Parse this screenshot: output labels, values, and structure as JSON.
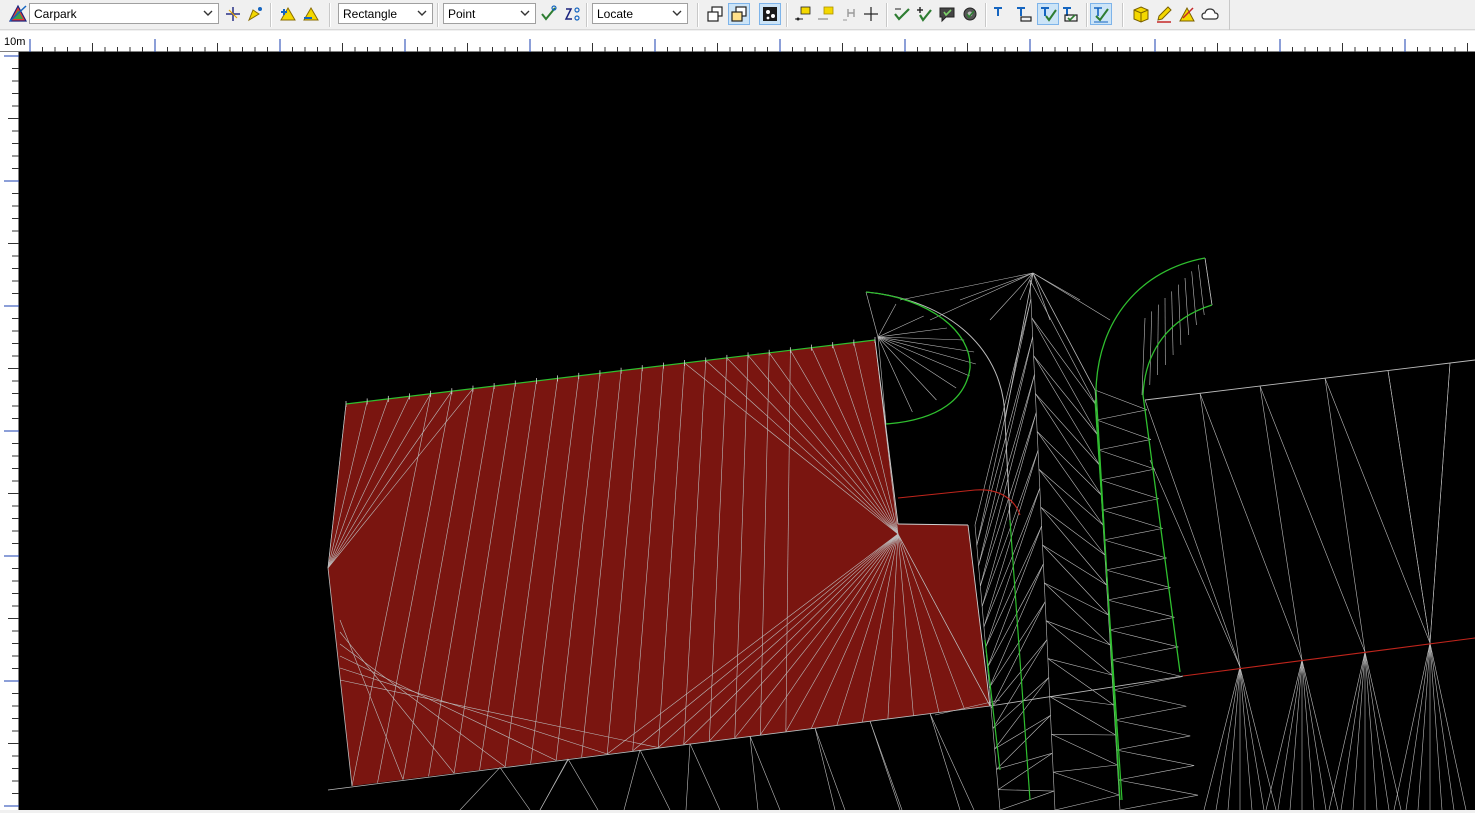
{
  "toolbar": {
    "layer_select": {
      "value": "Carpark"
    },
    "selection_mode_select": {
      "value": "Rectangle"
    },
    "snap_mode_select": {
      "value": "Point"
    },
    "action_select": {
      "value": "Locate"
    },
    "icons": [
      "layer-colour-icon",
      "crosshair-icon",
      "pen-select-icon",
      "triangle-add-icon",
      "triangle-remove-icon",
      "point-check-icon",
      "point-edit-icon",
      "copy-window-icon",
      "move-window-icon",
      "model-view-icon",
      "label-points-icon",
      "label-points-yellow-icon",
      "height-icon",
      "snap-cross-icon",
      "check-icon",
      "add-check-icon",
      "comment-icon",
      "settings-check-icon",
      "text-icon",
      "text-underline-icon",
      "text-check-icon",
      "text-underline-check-icon",
      "check-text-icon",
      "cube-icon",
      "pencil-icon",
      "shape-edit-icon",
      "cloud-icon"
    ]
  },
  "ruler": {
    "scale_label": "10m"
  },
  "colors": {
    "canvas_bg": "#000000",
    "surface_fill": "#7a1510",
    "mesh_line": "#bcbcbc",
    "breakline_green": "#2fbf2f",
    "breakline_red": "#c0251c"
  }
}
